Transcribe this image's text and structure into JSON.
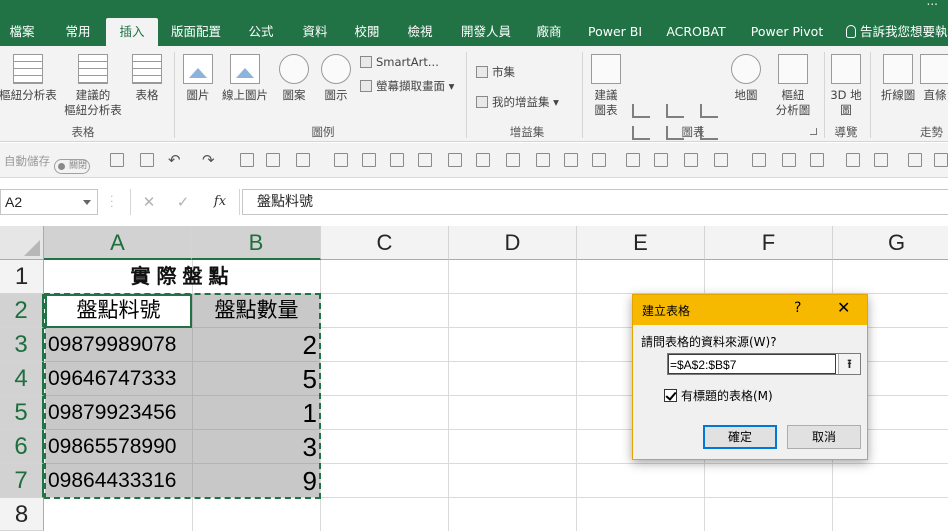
{
  "user_name": "...",
  "tabs": [
    "檔案",
    "常用",
    "插入",
    "版面配置",
    "公式",
    "資料",
    "校閱",
    "檢視",
    "開發人員",
    "廠商",
    "Power BI",
    "ACROBAT",
    "Power Pivot"
  ],
  "active_tab": "插入",
  "tell_me": "告訴我您想要執",
  "ribbon": {
    "tables": {
      "pivot": "樞紐分析表",
      "recommended_1": "建議的",
      "recommended_2": "樞紐分析表",
      "table": "表格",
      "group": "表格"
    },
    "illustrations": {
      "pictures": "圖片",
      "online_pictures": "線上圖片",
      "shapes": "圖案",
      "icons": "圖示",
      "smartart": "SmartArt...",
      "screenshot": "螢幕擷取畫面",
      "group": "圖例"
    },
    "addins": {
      "store": "市集",
      "my_addins": "我的增益集",
      "group": "增益集"
    },
    "charts": {
      "recommended_1": "建議",
      "recommended_2": "圖表",
      "maps": "地圖",
      "pivotchart_1": "樞紐",
      "pivotchart_2": "分析圖",
      "group": "圖表"
    },
    "tours": {
      "map3d_1": "3D 地",
      "map3d_2": "圖",
      "group": "導覽"
    },
    "sparklines": {
      "line": "折線圖",
      "column": "直條",
      "group": "走勢"
    }
  },
  "qat": {
    "autosave": "自動儲存",
    "autosave_state": "關閉"
  },
  "formula_bar": {
    "name_box": "A2",
    "cancel": "✕",
    "enter": "✓",
    "fx": "fx",
    "content": "盤點料號"
  },
  "columns": [
    "A",
    "B",
    "C",
    "D",
    "E",
    "F",
    "G"
  ],
  "rows": [
    "1",
    "2",
    "3",
    "4",
    "5",
    "6",
    "7",
    "8"
  ],
  "sheet": {
    "title": "實際盤點",
    "header_a": "盤點料號",
    "header_b": "盤點數量",
    "data": [
      {
        "part": "09879989078",
        "qty": "2"
      },
      {
        "part": "09646747333",
        "qty": "5"
      },
      {
        "part": "09879923456",
        "qty": "1"
      },
      {
        "part": "09865578990",
        "qty": "3"
      },
      {
        "part": "09864433316",
        "qty": "9"
      }
    ]
  },
  "dialog": {
    "title": "建立表格",
    "help": "?",
    "close": "✕",
    "source_label": "請問表格的資料來源(W)?",
    "source_value": "=$A$2:$B$7",
    "collapse": "⭱",
    "has_headers": "有標題的表格(M)",
    "ok": "確定",
    "cancel": "取消"
  },
  "colors": {
    "excel_green": "#217346",
    "dialog_title": "#f7b900",
    "selection_grey": "#c8c8c8"
  }
}
